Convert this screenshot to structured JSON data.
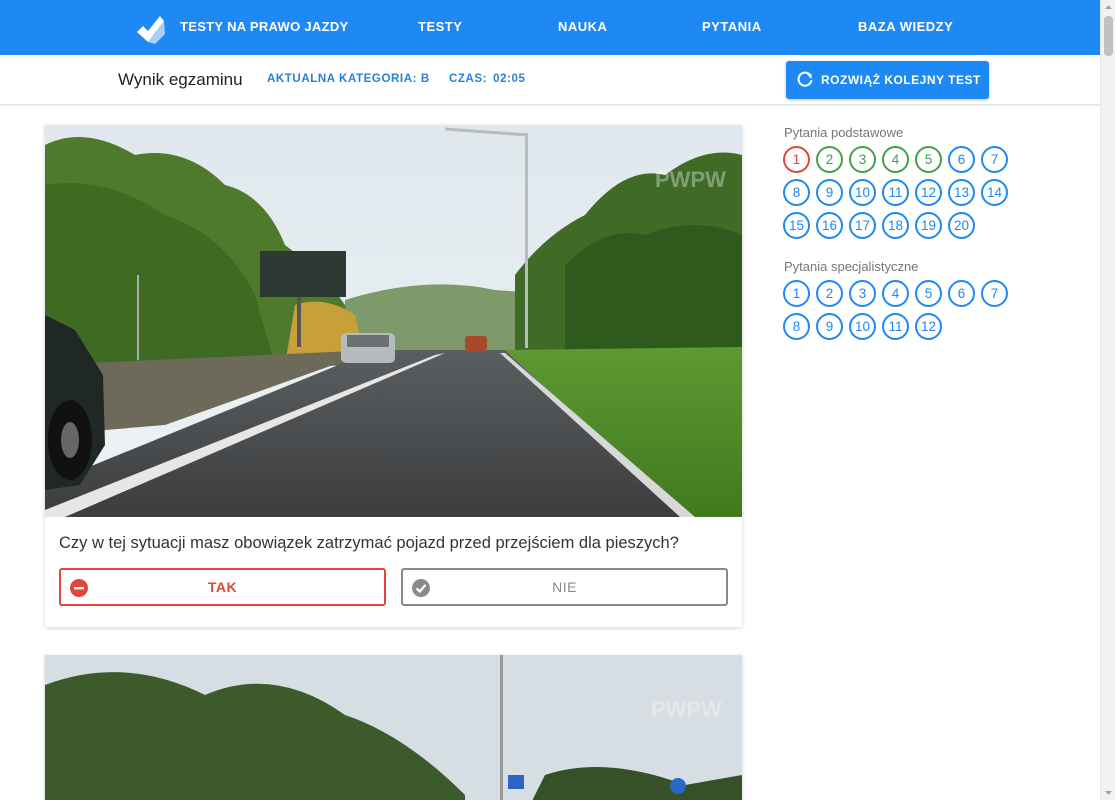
{
  "nav": {
    "brand": "TESTY NA PRAWO JAZDY",
    "links": [
      "TESTY",
      "NAUKA",
      "PYTANIA",
      "BAZA WIEDZY"
    ]
  },
  "subbar": {
    "title": "Wynik egzaminu",
    "category": "AKTUALNA KATEGORIA: B",
    "time_label": "CZAS:",
    "time_value": "02:05",
    "next_test_label": "ROZWIĄŻ KOLEJNY TEST"
  },
  "question": {
    "text": "Czy w tej sytuacji masz obowiązek zatrzymać pojazd przed przejściem dla pieszych?",
    "answers": [
      "TAK",
      "NIE"
    ],
    "image_watermark": "PWPW"
  },
  "sidebar": {
    "basic_title": "Pytania podstawowe",
    "basic": [
      {
        "n": "1",
        "status": "wrong"
      },
      {
        "n": "2",
        "status": "correct"
      },
      {
        "n": "3",
        "status": "correct"
      },
      {
        "n": "4",
        "status": "correct"
      },
      {
        "n": "5",
        "status": "correct"
      },
      {
        "n": "6",
        "status": "unanswered"
      },
      {
        "n": "7",
        "status": "unanswered"
      },
      {
        "n": "8",
        "status": "unanswered"
      },
      {
        "n": "9",
        "status": "unanswered"
      },
      {
        "n": "10",
        "status": "unanswered"
      },
      {
        "n": "11",
        "status": "unanswered"
      },
      {
        "n": "12",
        "status": "unanswered"
      },
      {
        "n": "13",
        "status": "unanswered"
      },
      {
        "n": "14",
        "status": "unanswered"
      },
      {
        "n": "15",
        "status": "unanswered"
      },
      {
        "n": "16",
        "status": "unanswered"
      },
      {
        "n": "17",
        "status": "unanswered"
      },
      {
        "n": "18",
        "status": "unanswered"
      },
      {
        "n": "19",
        "status": "unanswered"
      },
      {
        "n": "20",
        "status": "unanswered"
      }
    ],
    "special_title": "Pytania specjalistyczne",
    "special": [
      {
        "n": "1",
        "status": "unanswered"
      },
      {
        "n": "2",
        "status": "unanswered"
      },
      {
        "n": "3",
        "status": "unanswered"
      },
      {
        "n": "4",
        "status": "unanswered"
      },
      {
        "n": "5",
        "status": "unanswered"
      },
      {
        "n": "6",
        "status": "unanswered"
      },
      {
        "n": "7",
        "status": "unanswered"
      },
      {
        "n": "8",
        "status": "unanswered"
      },
      {
        "n": "9",
        "status": "unanswered"
      },
      {
        "n": "10",
        "status": "unanswered"
      },
      {
        "n": "11",
        "status": "unanswered"
      },
      {
        "n": "12",
        "status": "unanswered"
      }
    ]
  },
  "colors": {
    "primary": "#1e88f5",
    "wrong": "#e0463b",
    "correct": "#43a047",
    "neutral": "#8a8a8a"
  },
  "icons": {
    "logo": "checkmark-logo-icon",
    "next_test": "refresh-icon",
    "tak": "minus-circle-icon",
    "nie": "check-circle-icon"
  }
}
